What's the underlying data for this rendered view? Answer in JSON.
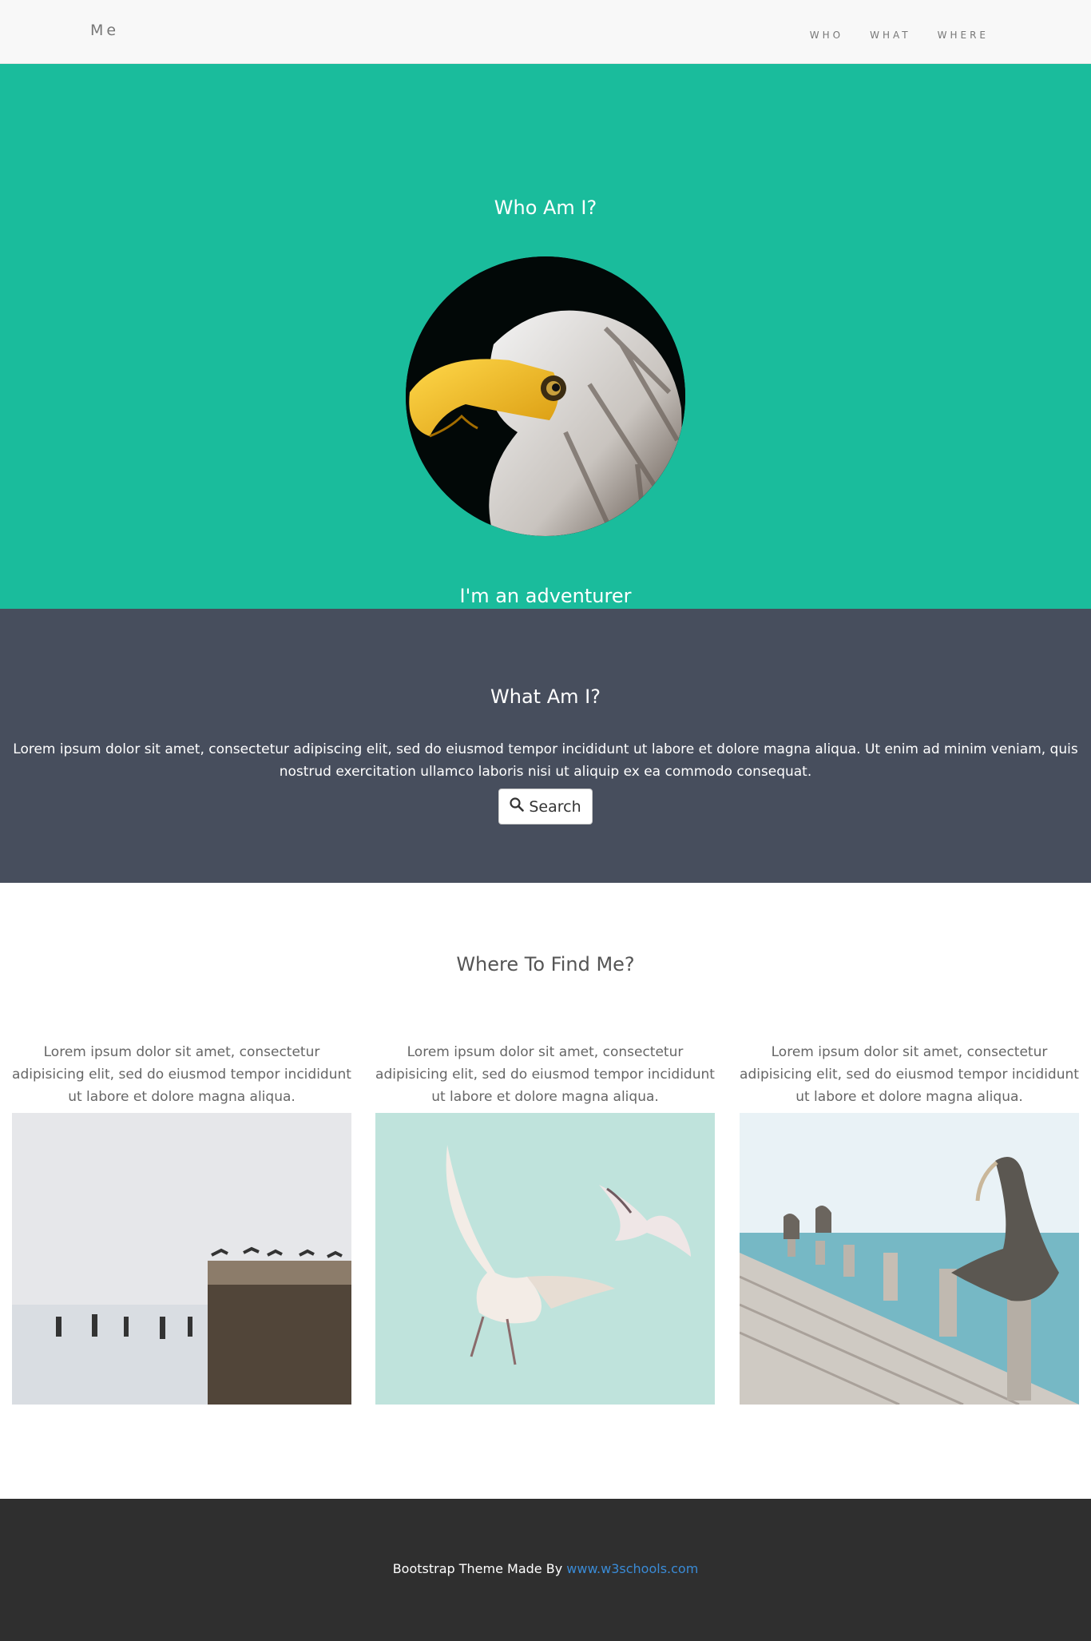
{
  "nav": {
    "brand": "Me",
    "links": [
      "WHO",
      "WHAT",
      "WHERE"
    ]
  },
  "who": {
    "title": "Who Am I?",
    "tagline": "I'm an adventurer",
    "bg_color": "#1abc9c"
  },
  "what": {
    "title": "What Am I?",
    "text": "Lorem ipsum dolor sit amet, consectetur adipiscing elit, sed do eiusmod tempor incididunt ut labore et dolore magna aliqua. Ut enim ad minim veniam, quis nostrud exercitation ullamco laboris nisi ut aliquip ex ea commodo consequat.",
    "button_label": "Search",
    "bg_color": "#474e5d"
  },
  "where": {
    "title": "Where To Find Me?",
    "columns": [
      {
        "text": "Lorem ipsum dolor sit amet, consectetur adipisicing elit, sed do eiusmod tempor incididunt ut labore et dolore magna aliqua."
      },
      {
        "text": "Lorem ipsum dolor sit amet, consectetur adipisicing elit, sed do eiusmod tempor incididunt ut labore et dolore magna aliqua."
      },
      {
        "text": "Lorem ipsum dolor sit amet, consectetur adipisicing elit, sed do eiusmod tempor incididunt ut labore et dolore magna aliqua."
      }
    ]
  },
  "footer": {
    "prefix": "Bootstrap Theme Made By ",
    "link": "www.w3schools.com",
    "bg_color": "#2f2f2f"
  }
}
